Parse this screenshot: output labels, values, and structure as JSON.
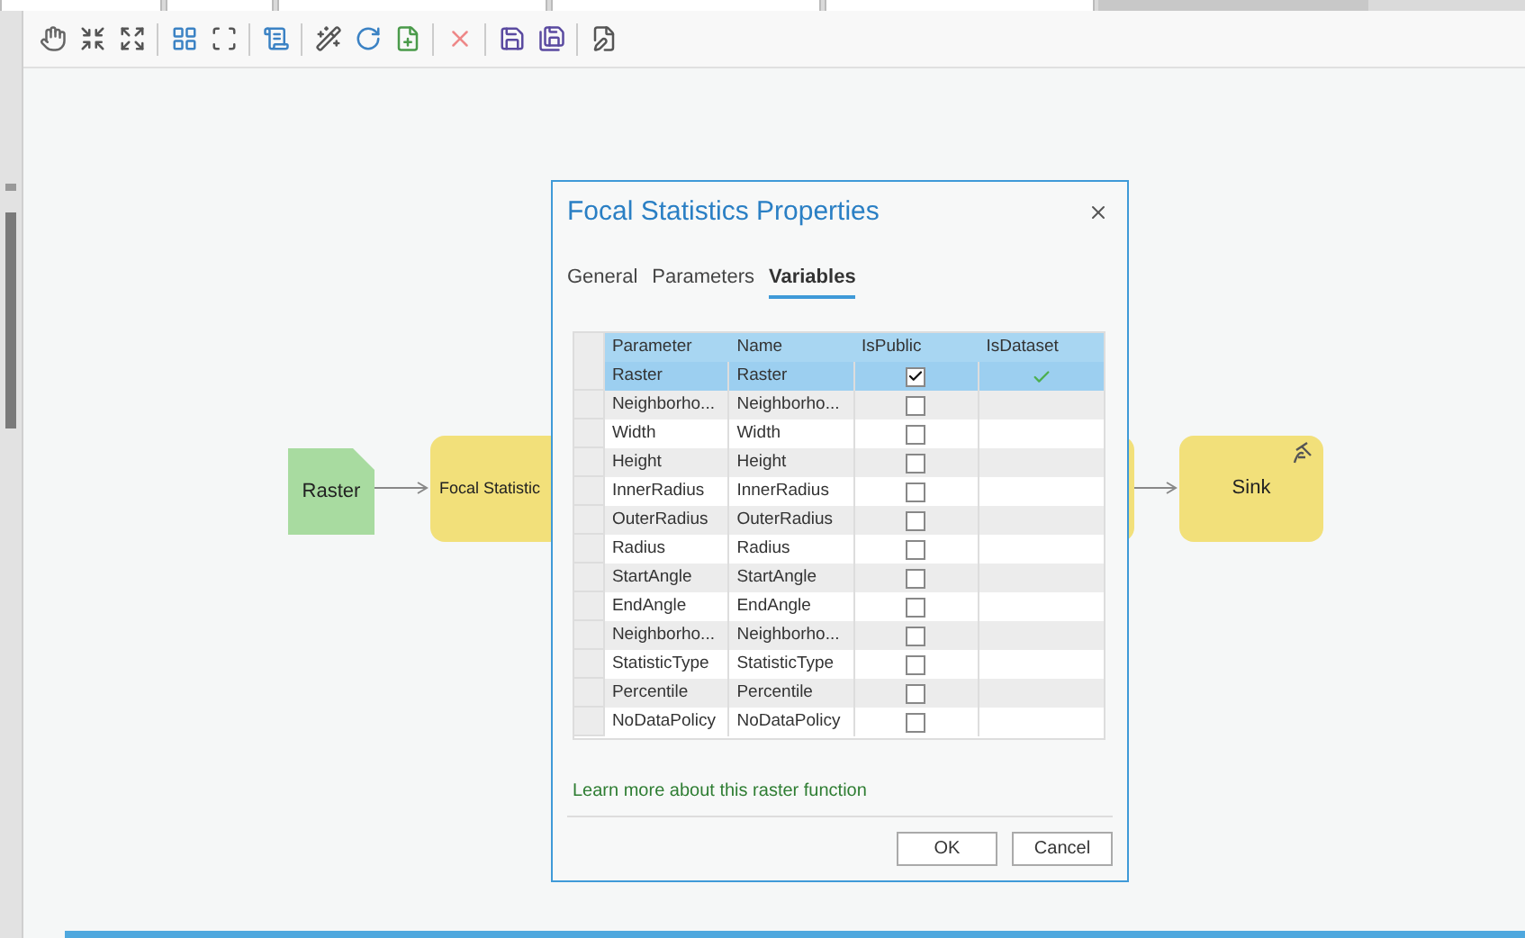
{
  "top_tabs": [
    {
      "selected": false
    },
    {
      "selected": false
    },
    {
      "selected": false
    },
    {
      "selected": false
    },
    {
      "selected": false
    },
    {
      "selected": true
    }
  ],
  "canvas": {
    "nodes": [
      {
        "label": "Raster",
        "kind": "data"
      },
      {
        "label": "Focal Statistic",
        "kind": "function"
      },
      {
        "label": "Sink",
        "kind": "sink"
      }
    ]
  },
  "dialog": {
    "title": "Focal Statistics Properties",
    "tabs": [
      {
        "label": "General",
        "selected": false
      },
      {
        "label": "Parameters",
        "selected": false
      },
      {
        "label": "Variables",
        "selected": true
      }
    ],
    "table": {
      "columns": [
        "Parameter",
        "Name",
        "IsPublic",
        "IsDataset"
      ],
      "rows": [
        {
          "parameter": "Raster",
          "name": "Raster",
          "is_public": true,
          "is_dataset": true,
          "selected": true
        },
        {
          "parameter": "Neighborho...",
          "name": "Neighborho...",
          "is_public": false,
          "is_dataset": false,
          "selected": false
        },
        {
          "parameter": "Width",
          "name": "Width",
          "is_public": false,
          "is_dataset": false,
          "selected": false
        },
        {
          "parameter": "Height",
          "name": "Height",
          "is_public": false,
          "is_dataset": false,
          "selected": false
        },
        {
          "parameter": "InnerRadius",
          "name": "InnerRadius",
          "is_public": false,
          "is_dataset": false,
          "selected": false
        },
        {
          "parameter": "OuterRadius",
          "name": "OuterRadius",
          "is_public": false,
          "is_dataset": false,
          "selected": false
        },
        {
          "parameter": "Radius",
          "name": "Radius",
          "is_public": false,
          "is_dataset": false,
          "selected": false
        },
        {
          "parameter": "StartAngle",
          "name": "StartAngle",
          "is_public": false,
          "is_dataset": false,
          "selected": false
        },
        {
          "parameter": "EndAngle",
          "name": "EndAngle",
          "is_public": false,
          "is_dataset": false,
          "selected": false
        },
        {
          "parameter": "Neighborho...",
          "name": "Neighborho...",
          "is_public": false,
          "is_dataset": false,
          "selected": false
        },
        {
          "parameter": "StatisticType",
          "name": "StatisticType",
          "is_public": false,
          "is_dataset": false,
          "selected": false
        },
        {
          "parameter": "Percentile",
          "name": "Percentile",
          "is_public": false,
          "is_dataset": false,
          "selected": false
        },
        {
          "parameter": "NoDataPolicy",
          "name": "NoDataPolicy",
          "is_public": false,
          "is_dataset": false,
          "selected": false
        }
      ]
    },
    "link": "Learn more about this raster function",
    "buttons": [
      "OK",
      "Cancel"
    ]
  }
}
